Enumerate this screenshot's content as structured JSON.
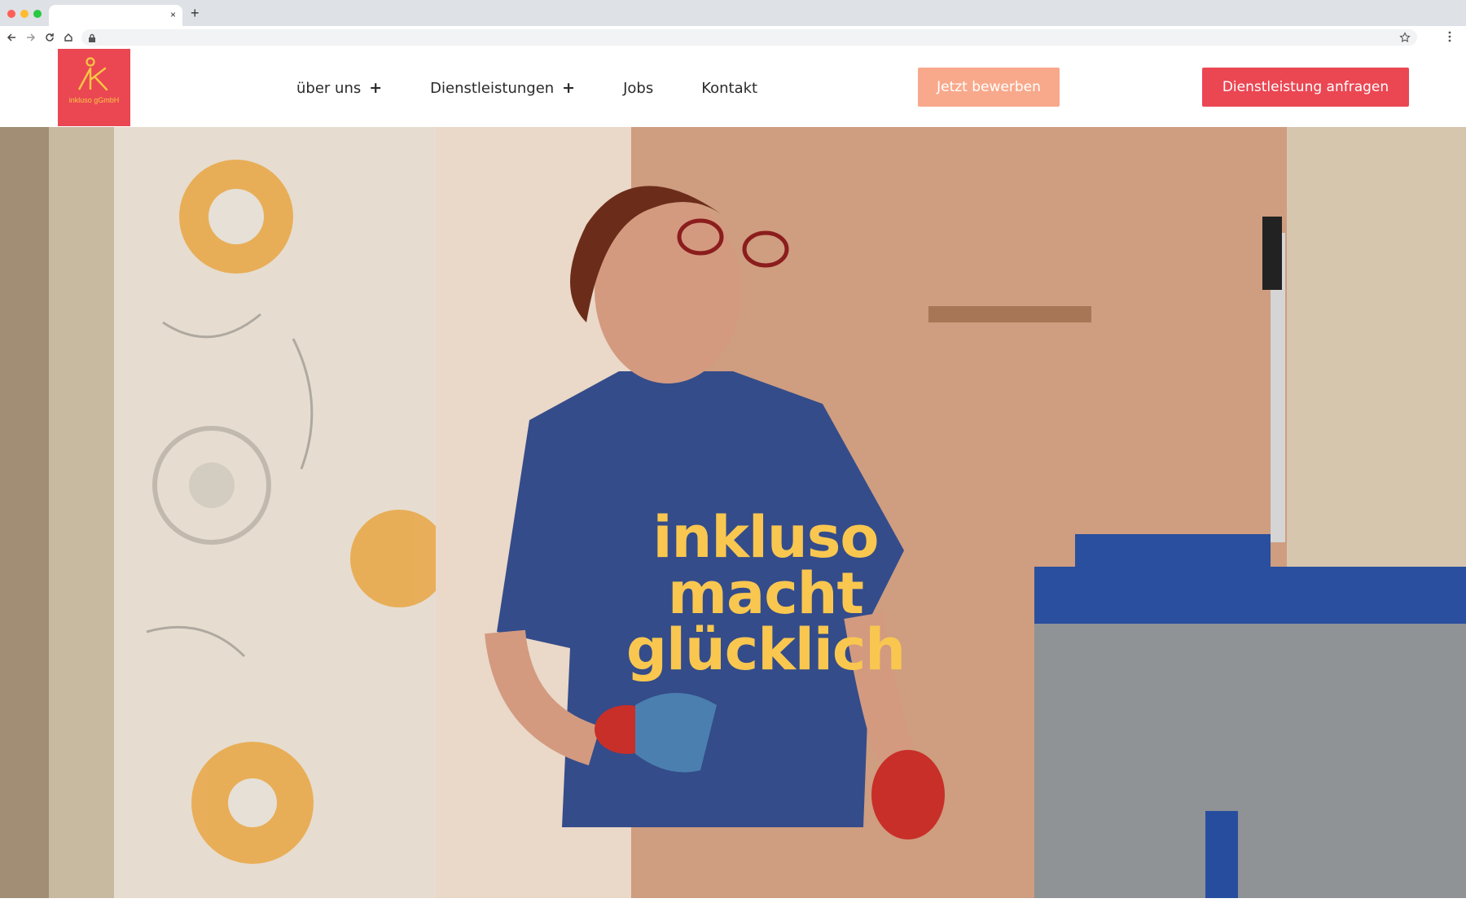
{
  "browser": {
    "tab_close_glyph": "×",
    "new_tab_glyph": "+",
    "icons": [
      "back-icon",
      "forward-icon",
      "reload-icon",
      "home-icon",
      "lock-icon",
      "star-icon",
      "menu-dots-icon"
    ]
  },
  "header": {
    "logo_text": "inkluso gGmbH",
    "nav": [
      {
        "label": "über uns",
        "has_submenu": true,
        "toggle": "+"
      },
      {
        "label": "Dienstleistungen",
        "has_submenu": true,
        "toggle": "+"
      },
      {
        "label": "Jobs",
        "has_submenu": false
      },
      {
        "label": "Kontakt",
        "has_submenu": false
      }
    ],
    "apply_button": "Jetzt bewerben",
    "request_button": "Dienstleistung anfragen"
  },
  "hero": {
    "title_lines": [
      "inkluso",
      "macht",
      "glücklich"
    ]
  },
  "colors": {
    "brand_red": "#ea4753",
    "brand_salmon": "#f8a98b",
    "brand_yellow": "#f9c74f",
    "nav_text": "#2b2b2b"
  }
}
